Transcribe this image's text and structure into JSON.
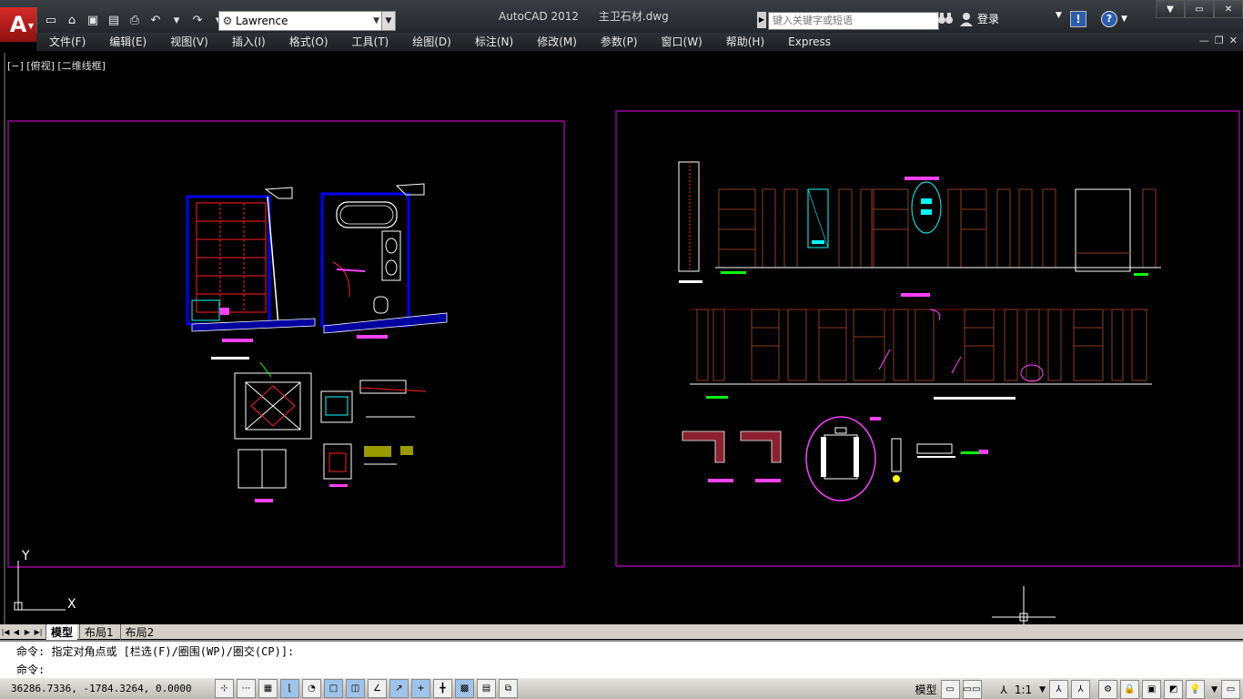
{
  "window": {
    "app_name": "AutoCAD 2012",
    "file_name": "主卫石材.dwg",
    "workspace": "Lawrence",
    "search_placeholder": "键入关键字或短语",
    "login_label": "登录"
  },
  "menu": {
    "items": [
      "文件(F)",
      "编辑(E)",
      "视图(V)",
      "插入(I)",
      "格式(O)",
      "工具(T)",
      "绘图(D)",
      "标注(N)",
      "修改(M)",
      "参数(P)",
      "窗口(W)",
      "帮助(H)",
      "Express"
    ]
  },
  "viewport": {
    "label": "[−] [俯视] [二维线框]"
  },
  "ucs": {
    "x_label": "X",
    "y_label": "Y"
  },
  "tabs": [
    "模型",
    "布局1",
    "布局2"
  ],
  "command": {
    "history_line": "命令: 指定对角点或 [栏选(F)/圈围(WP)/圈交(CP)]:",
    "prompt": "命令:"
  },
  "status": {
    "coordinates": "36286.7336, -1784.3264, 0.0000",
    "model_label": "模型",
    "scale_label": "1:1"
  },
  "colors": {
    "layout_frame": "#c000c0",
    "wall": "#0000ff",
    "dim_red": "#ff2020",
    "cyan": "#00ffff",
    "green": "#00ff00",
    "magenta": "#ff40ff",
    "brown": "#8b3a20"
  }
}
